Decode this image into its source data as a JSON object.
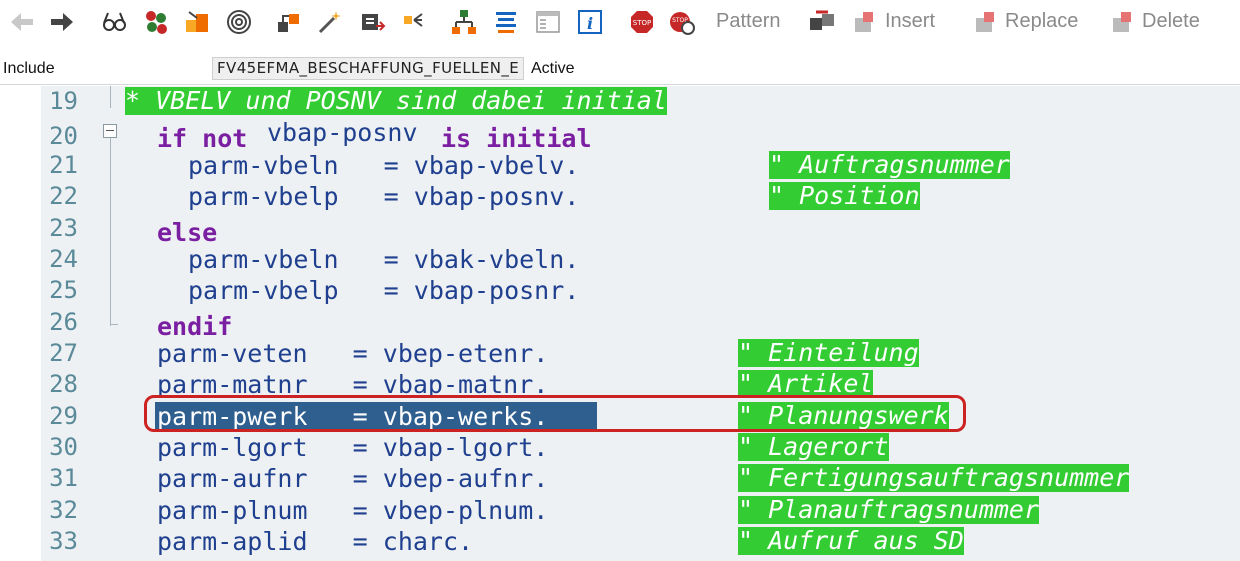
{
  "toolbar": {
    "icons": [
      "back-arrow-icon",
      "forward-arrow-icon",
      "glasses-icon",
      "objects-icon",
      "transport-icon",
      "spiral-icon",
      "activate-icon",
      "magic-wand-icon",
      "pretty-printer-icon",
      "where-used-icon",
      "hierarchy-icon",
      "stack-icon",
      "form-icon",
      "info-icon",
      "stop-sign-icon",
      "stop-bomb-icon"
    ],
    "pattern_label": "Pattern",
    "insert_label": "Insert",
    "replace_label": "Replace",
    "delete_label": "Delete"
  },
  "include_bar": {
    "label": "Include",
    "name": "FV45EFMA_BESCHAFFUNG_FUELLEN_E",
    "status": "Active"
  },
  "code": {
    "lines": [
      {
        "num": "19",
        "text": "",
        "comment": "* VBELV und POSNV sind dabei initial"
      },
      {
        "num": "20",
        "kw1": "if not",
        "text": "vbap-posnv",
        "kw2": "is initial",
        "comment": ""
      },
      {
        "num": "21",
        "text": "parm-vbeln   = vbap-vbelv.",
        "comment": "\" Auftragsnummer"
      },
      {
        "num": "22",
        "text": "parm-vbelp   = vbap-posnv.",
        "comment": "\" Position"
      },
      {
        "num": "23",
        "kw1": "else",
        "text": "",
        "comment": ""
      },
      {
        "num": "24",
        "text": "parm-vbeln   = vbak-vbeln.",
        "comment": ""
      },
      {
        "num": "25",
        "text": "parm-vbelp   = vbap-posnr.",
        "comment": ""
      },
      {
        "num": "26",
        "kw1": "endif",
        "text": "",
        "comment": ""
      },
      {
        "num": "27",
        "text": "parm-veten   = vbep-etenr.",
        "comment": "\" Einteilung"
      },
      {
        "num": "28",
        "text": "parm-matnr   = vbap-matnr.",
        "comment": "\" Artikel"
      },
      {
        "num": "29",
        "text": "parm-pwerk   = vbap-werks.",
        "comment": "\" Planungswerk"
      },
      {
        "num": "30",
        "text": "parm-lgort   = vbap-lgort.",
        "comment": "\" Lagerort"
      },
      {
        "num": "31",
        "text": "parm-aufnr   = vbep-aufnr.",
        "comment": "\" Fertigungsauftragsnummer"
      },
      {
        "num": "32",
        "text": "parm-plnum   = vbep-plnum.",
        "comment": "\" Planauftragsnummer"
      },
      {
        "num": "33",
        "text": "parm-aplid   = charc.",
        "comment": "\" Aufruf aus SD"
      }
    ]
  },
  "colors": {
    "comment_bg": "#33cc33",
    "keyword": "#7b1fa2",
    "code_text": "#1f3f8f",
    "selection": "#2f5f8f",
    "highlight_box": "#cc2222"
  }
}
